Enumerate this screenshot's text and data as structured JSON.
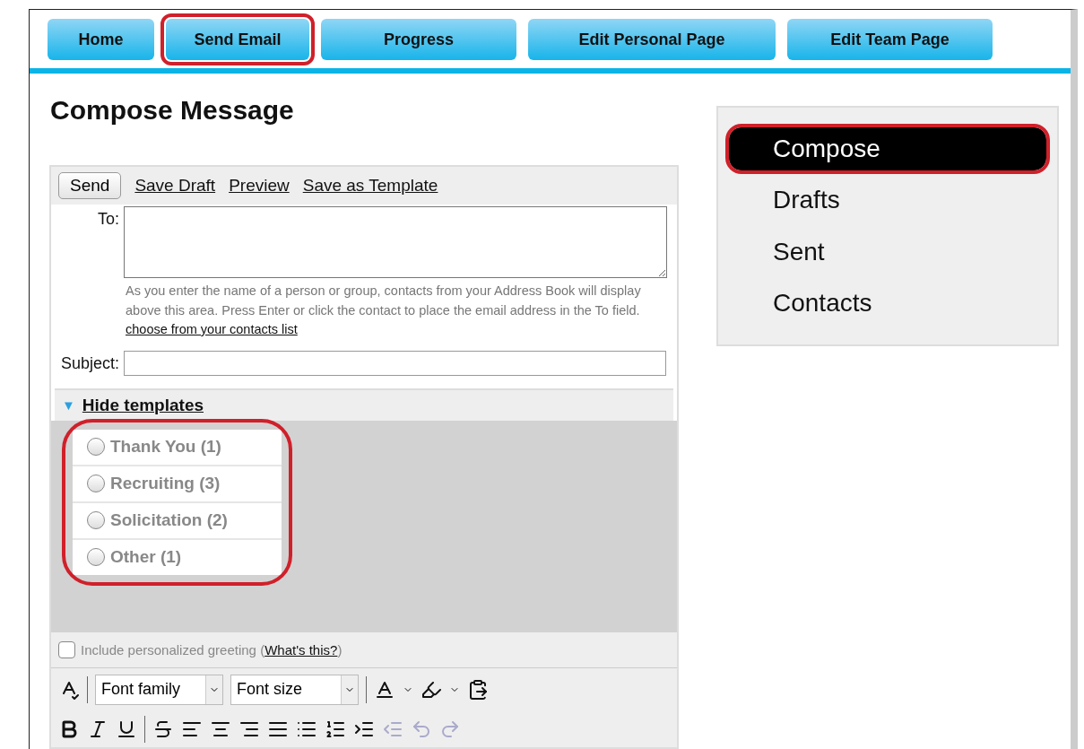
{
  "nav": {
    "tabs": [
      {
        "label": "Home",
        "selected": false,
        "highlighted": false
      },
      {
        "label": "Send Email",
        "selected": false,
        "highlighted": true
      },
      {
        "label": "Progress",
        "selected": false,
        "highlighted": false
      },
      {
        "label": "Edit Personal Page",
        "selected": false,
        "highlighted": false
      },
      {
        "label": "Edit Team Page",
        "selected": false,
        "highlighted": false
      }
    ]
  },
  "page_title": "Compose Message",
  "compose": {
    "actions": [
      {
        "kind": "button",
        "label": "Send"
      },
      {
        "kind": "link",
        "label": "Save Draft"
      },
      {
        "kind": "link",
        "label": "Preview"
      },
      {
        "kind": "link",
        "label": "Save as Template"
      }
    ],
    "to": {
      "label": "To:"
    },
    "to_help": "As you enter the name of a person or group, contacts from your Address Book will display above this area. Press Enter or click the contact to place the email address in the To field.",
    "to_help_link": "choose from your contacts list",
    "subject": {
      "label": "Subject:"
    },
    "templates": {
      "toggle": "▼",
      "label": "Hide templates",
      "expanded": true,
      "highlighted": true,
      "items": [
        {
          "label": "Thank You (1)",
          "selected": false
        },
        {
          "label": "Recruiting (3)",
          "selected": false
        },
        {
          "label": "Solicitation (2)",
          "selected": false
        },
        {
          "label": "Other (1)",
          "selected": false
        }
      ]
    },
    "greeting": {
      "label": "Include personalized greeting (",
      "link": "What's this?",
      "suffix": ")",
      "checked": false
    },
    "editor_toolbar": {
      "rows": [
        [
          {
            "kind": "spellcheck",
            "disabled": false
          },
          {
            "kind": "sep"
          },
          {
            "kind": "select",
            "value": "Font family"
          },
          {
            "kind": "select",
            "value": "Font size"
          },
          {
            "kind": "sep"
          },
          {
            "kind": "fontcolor",
            "disabled": false
          },
          {
            "kind": "highlight",
            "disabled": false
          },
          {
            "kind": "pasteword",
            "disabled": false
          }
        ],
        [
          {
            "kind": "bold",
            "disabled": false
          },
          {
            "kind": "italic",
            "disabled": false
          },
          {
            "kind": "underline",
            "disabled": false
          },
          {
            "kind": "sep"
          },
          {
            "kind": "strike",
            "disabled": false
          },
          {
            "kind": "alignleft",
            "disabled": false
          },
          {
            "kind": "aligncenter",
            "disabled": false
          },
          {
            "kind": "alignright",
            "disabled": false
          },
          {
            "kind": "justify",
            "disabled": false
          },
          {
            "kind": "bullets",
            "disabled": false
          },
          {
            "kind": "numbers",
            "disabled": false
          },
          {
            "kind": "indent",
            "disabled": false
          },
          {
            "kind": "outdent",
            "disabled": true
          },
          {
            "kind": "undo",
            "disabled": true
          },
          {
            "kind": "redo",
            "disabled": true
          }
        ]
      ]
    }
  },
  "sidebar": {
    "items": [
      {
        "label": "Compose",
        "selected": true,
        "highlighted": true
      },
      {
        "label": "Drafts",
        "selected": false,
        "highlighted": false
      },
      {
        "label": "Sent",
        "selected": false,
        "highlighted": false
      },
      {
        "label": "Contacts",
        "selected": false,
        "highlighted": false
      }
    ]
  }
}
